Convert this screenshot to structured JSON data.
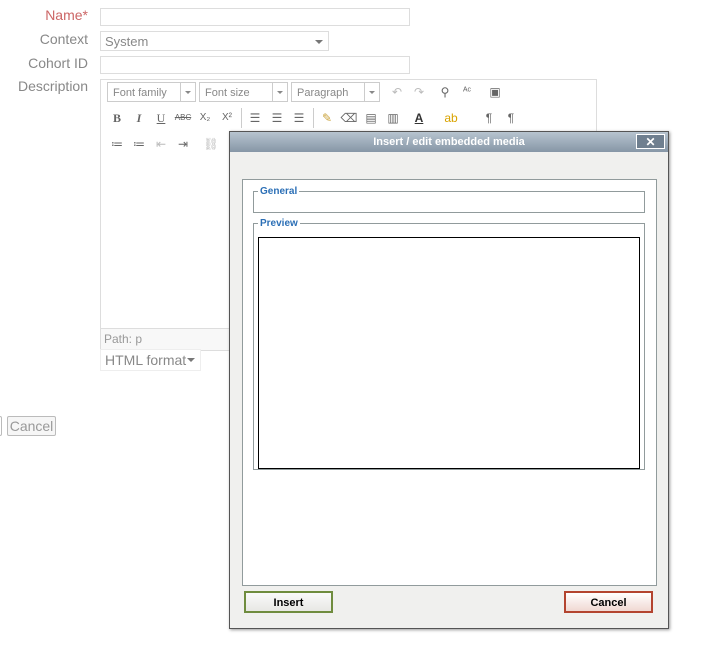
{
  "form": {
    "name_label": "Name",
    "name_required": "*",
    "context_label": "Context",
    "context_value": "System",
    "cohort_label": "Cohort ID",
    "description_label": "Description",
    "cancel_label": "Cancel",
    "format_value": "HTML format"
  },
  "editor": {
    "font_family": "Font family",
    "font_size": "Font size",
    "paragraph": "Paragraph",
    "path": "Path: p",
    "buttons": {
      "bold": "B",
      "italic": "I",
      "underline": "U",
      "strike": "ABC",
      "subscript": "X₂",
      "superscript": "X²",
      "text_color": "A"
    }
  },
  "dialog": {
    "title": "Insert / edit embedded media",
    "close": "✕",
    "general_legend": "General",
    "preview_legend": "Preview",
    "insert_label": "Insert",
    "cancel_label": "Cancel"
  },
  "colors": {
    "required": "#cc6666",
    "legend": "#2b6fb6",
    "insert_border": "#6f8c3e",
    "cancel_border": "#b3442f"
  }
}
